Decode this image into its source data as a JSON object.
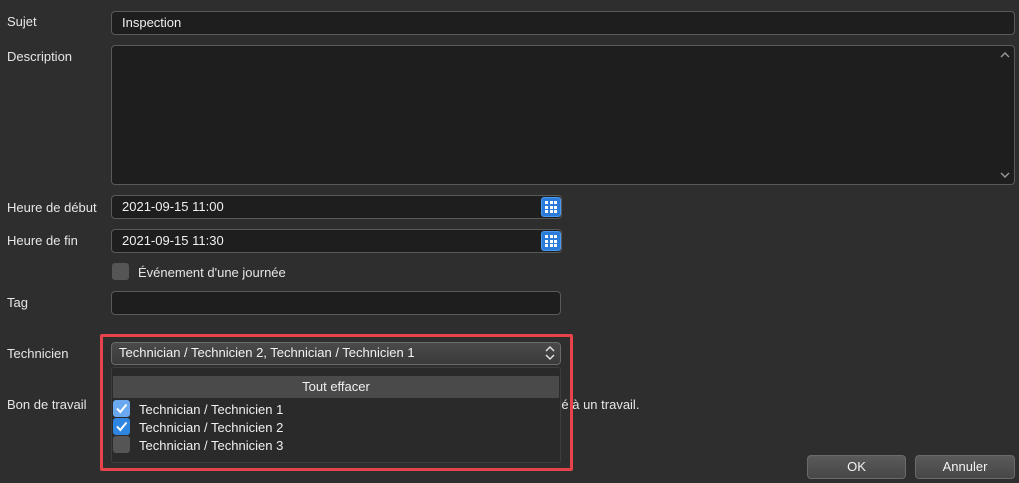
{
  "form": {
    "subject_label": "Sujet",
    "subject_value": "Inspection",
    "description_label": "Description",
    "description_value": "",
    "start_label": "Heure de début",
    "start_value": "2021-09-15 11:00",
    "end_label": "Heure de fin",
    "end_value": "2021-09-15 11:30",
    "all_day_label": "Événement d'une journée",
    "all_day_checked": false,
    "tag_label": "Tag",
    "tag_value": "",
    "technician_label": "Technicien",
    "technician_value": "Technician / Technicien 2, Technician / Technicien 1",
    "work_order_label": "Bon de travail",
    "work_order_hint_partial": "cié à un travail."
  },
  "technician_dropdown": {
    "clear_all_label": "Tout effacer",
    "options": [
      {
        "label": "Technician / Technicien 1",
        "checked": true
      },
      {
        "label": "Technician / Technicien 2",
        "checked": true
      },
      {
        "label": "Technician / Technicien 3",
        "checked": false
      }
    ]
  },
  "buttons": {
    "ok_label": "OK",
    "cancel_label": "Annuler"
  },
  "colors": {
    "background": "#2e2e2e",
    "field_background": "#1e1e1e",
    "accent": "#2f86e0",
    "highlight": "#e8434a"
  },
  "icons": {
    "calendar": "calendar-grid-icon",
    "updown": "updown-chevron-icon",
    "check": "checkmark-icon"
  }
}
